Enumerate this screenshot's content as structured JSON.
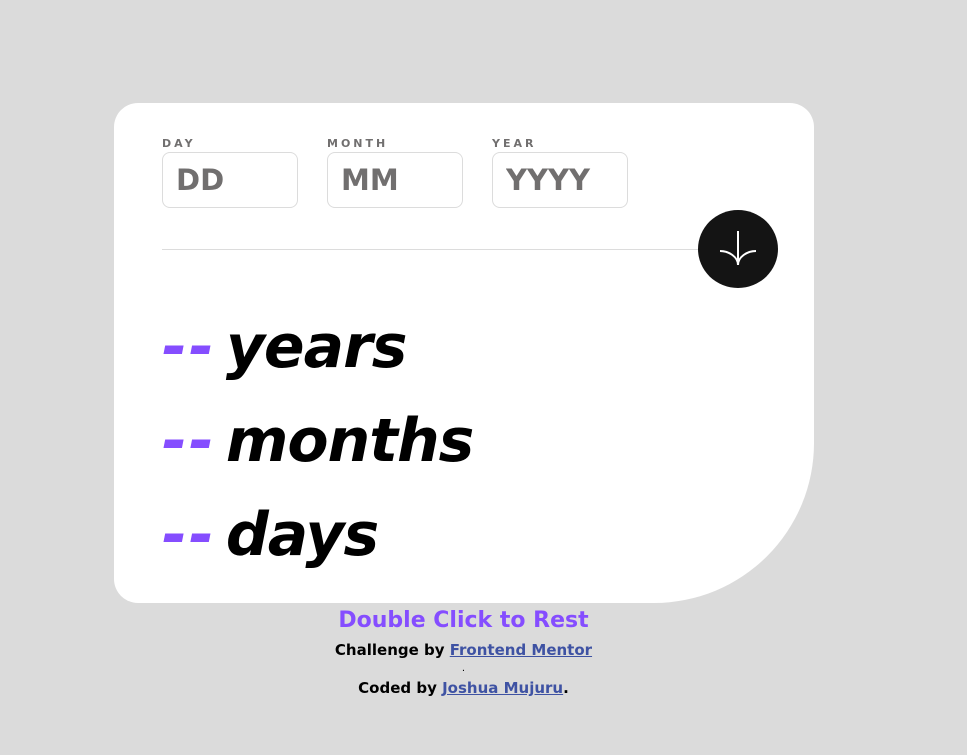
{
  "form": {
    "day": {
      "label": "DAY",
      "placeholder": "DD",
      "value": ""
    },
    "month": {
      "label": "MONTH",
      "placeholder": "MM",
      "value": ""
    },
    "year": {
      "label": "YEAR",
      "placeholder": "YYYY",
      "value": ""
    }
  },
  "submit": {
    "icon": "arrow-down-icon"
  },
  "results": {
    "years": {
      "value": "--",
      "unit": "years"
    },
    "months": {
      "value": "--",
      "unit": "months"
    },
    "days": {
      "value": "--",
      "unit": "days"
    }
  },
  "footer": {
    "hint": "Double Click to Rest",
    "challenge_prefix": "Challenge by ",
    "challenge_link": "Frontend Mentor",
    "separator": ".",
    "coded_prefix": "Coded by ",
    "coded_link": "Joshua Mujuru",
    "coded_suffix": "."
  },
  "colors": {
    "accent": "#854dff",
    "background": "#dbdbdb",
    "card": "#ffffff",
    "button": "#141414",
    "link": "#3e52a3"
  }
}
